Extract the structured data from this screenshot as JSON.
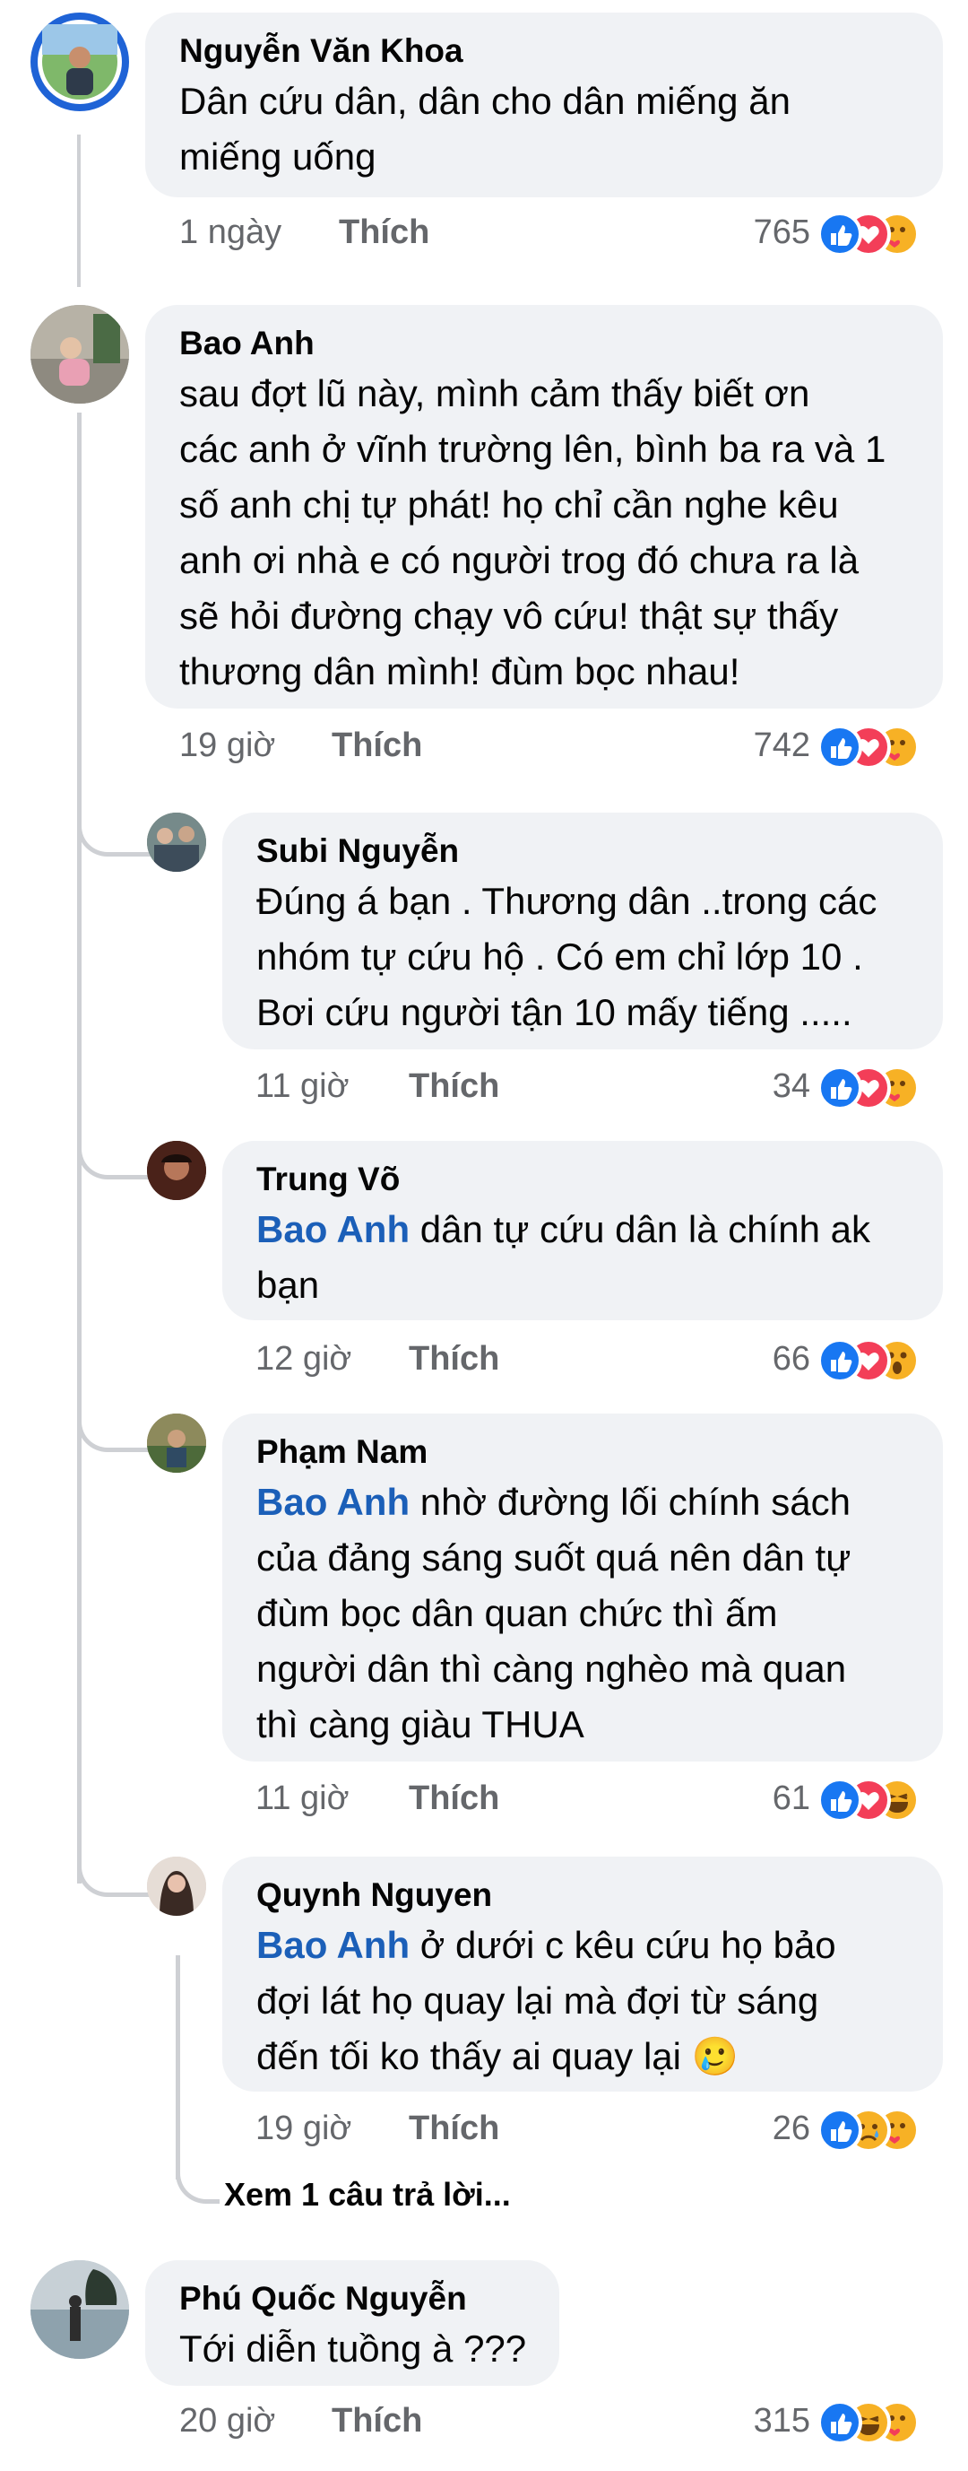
{
  "comments": [
    {
      "author": "Nguyễn Văn Khoa",
      "lines": [
        "Dân cứu dân, dân cho dân miếng ăn",
        "miếng uống"
      ],
      "time": "1 ngày",
      "like_label": "Thích",
      "count": "765",
      "reactions": [
        "like-icon",
        "love-icon",
        "care-icon"
      ]
    },
    {
      "author": "Bao Anh",
      "lines": [
        "sau đợt lũ này, mình cảm thấy biết ơn",
        "các anh ở vĩnh trường lên, bình ba ra và 1",
        "số anh chị tự phát! họ chỉ cần nghe kêu",
        "anh ơi nhà e có người trog đó chưa ra là",
        "sẽ hỏi đường chạy vô cứu! thật sự thấy",
        "thương dân mình! đùm bọc nhau!"
      ],
      "time": "19 giờ",
      "like_label": "Thích",
      "count": "742",
      "reactions": [
        "like-icon",
        "love-icon",
        "care-icon"
      ]
    }
  ],
  "replies": [
    {
      "author": "Subi Nguyễn",
      "lines": [
        "Đúng á bạn . Thương dân ..trong các",
        "nhóm tự cứu hộ . Có em chỉ lớp 10 .",
        "Bơi cứu người tận 10 mấy tiếng ....."
      ],
      "time": "11 giờ",
      "like_label": "Thích",
      "count": "34",
      "reactions": [
        "like-icon",
        "love-icon",
        "care-icon"
      ]
    },
    {
      "author": "Trung Võ",
      "mention": "Bao Anh",
      "lines": [
        " dân tự cứu dân là chính ak",
        "bạn"
      ],
      "time": "12 giờ",
      "like_label": "Thích",
      "count": "66",
      "reactions": [
        "like-icon",
        "love-icon",
        "wow-icon"
      ]
    },
    {
      "author": "Phạm Nam",
      "mention": "Bao Anh",
      "lines": [
        " nhờ đường lối chính sách",
        "của đảng sáng suốt quá nên dân tự",
        "đùm bọc dân quan chức thì ấm",
        "người dân thì càng nghèo mà quan",
        "thì càng giàu THUA"
      ],
      "time": "11 giờ",
      "like_label": "Thích",
      "count": "61",
      "reactions": [
        "like-icon",
        "love-icon",
        "haha-icon"
      ]
    },
    {
      "author": "Quynh Nguyen",
      "mention": "Bao Anh",
      "lines": [
        " ở dưới c kêu cứu họ bảo",
        "đợi lát họ quay lại mà đợi từ sáng",
        "đến tối ko thấy ai quay lại 🥲"
      ],
      "time": "19 giờ",
      "like_label": "Thích",
      "count": "26",
      "reactions": [
        "like-icon",
        "sad-icon",
        "care-icon"
      ]
    }
  ],
  "view_more": "Xem 1 câu trả lời...",
  "last_comment": {
    "author": "Phú Quốc Nguyễn",
    "lines": [
      "Tới diễn tuồng à ???"
    ],
    "time": "20 giờ",
    "like_label": "Thích",
    "count": "315",
    "reactions": [
      "like-icon",
      "haha-icon",
      "care-icon"
    ]
  },
  "colors": {
    "bubble": "#f0f2f5",
    "mention": "#1b5fb8",
    "meta": "#65676b",
    "like": "#1877f2",
    "love": "#f33e58",
    "reaction_yellow": "#f7b125"
  }
}
